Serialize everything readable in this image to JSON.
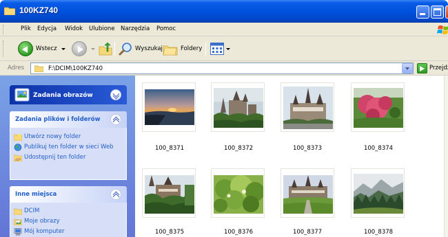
{
  "window": {
    "title": "100KZ740"
  },
  "menubar": {
    "items": [
      "Plik",
      "Edycja",
      "Widok",
      "Ulubione",
      "Narzędzia",
      "Pomoc"
    ]
  },
  "toolbar": {
    "back_label": "Wstecz",
    "search_label": "Wyszukaj",
    "folders_label": "Foldery"
  },
  "addressbar": {
    "label": "Adres",
    "path": "F:\\DCIM\\100KZ740",
    "go_label": "Przejdź"
  },
  "taskpane": {
    "picture_tasks": {
      "title": "Zadania obrazów"
    },
    "file_tasks": {
      "title": "Zadania plików i folderów",
      "items": [
        "Utwórz nowy folder",
        "Publikuj ten folder w sieci Web",
        "Udostępnij ten folder"
      ]
    },
    "other_places": {
      "title": "Inne miejsca",
      "items": [
        "DCIM",
        "Moje obrazy",
        "Mój komputer"
      ]
    }
  },
  "files": [
    {
      "name": "100_8371",
      "scene": "sunset"
    },
    {
      "name": "100_8372",
      "scene": "castle"
    },
    {
      "name": "100_8373",
      "scene": "palace"
    },
    {
      "name": "100_8374",
      "scene": "pink-tree"
    },
    {
      "name": "100_8375",
      "scene": "castle-garden"
    },
    {
      "name": "100_8376",
      "scene": "bushes"
    },
    {
      "name": "100_8377",
      "scene": "palace-lawn"
    },
    {
      "name": "100_8378",
      "scene": "mountain-forest"
    }
  ],
  "colors": {
    "titlebar": "#0052dd",
    "taskpane": "#6f8ee0",
    "link": "#215dc6"
  }
}
